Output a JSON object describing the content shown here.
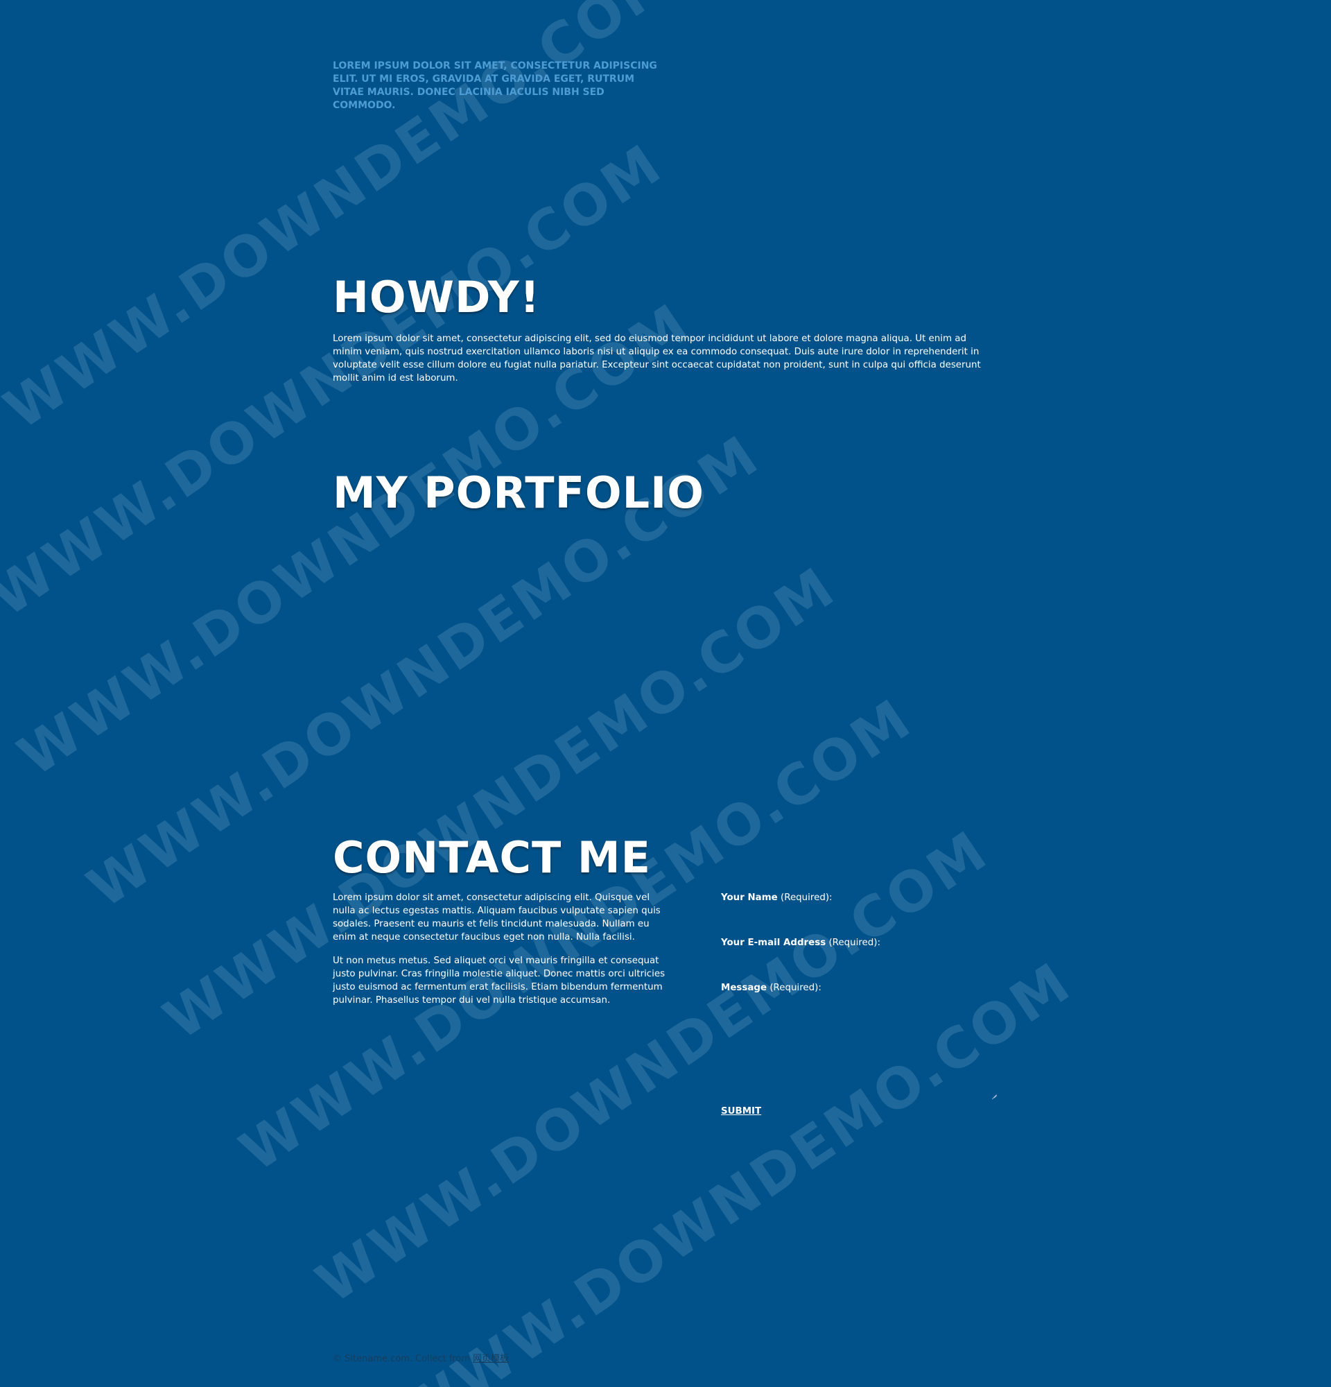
{
  "header": {
    "tagline": "Lorem ipsum dolor sit amet, consectetur adipiscing elit. Ut mi eros, gravida at gravida eget, rutrum vitae mauris. Donec lacinia iaculis nibh sed commodo."
  },
  "howdy": {
    "title": "HOWDY!",
    "text": "Lorem ipsum dolor sit amet, consectetur adipiscing elit, sed do eiusmod tempor incididunt ut labore et dolore magna aliqua. Ut enim ad minim veniam, quis nostrud exercitation ullamco laboris nisi ut aliquip ex ea commodo consequat. Duis aute irure dolor in reprehenderit in voluptate velit esse cillum dolore eu fugiat nulla pariatur. Excepteur sint occaecat cupidatat non proident, sunt in culpa qui officia deserunt mollit anim id est laborum."
  },
  "portfolio": {
    "title": "MY PORTFOLIO"
  },
  "contact": {
    "title": "CONTACT ME",
    "paragraphs": [
      "Lorem ipsum dolor sit amet, consectetur adipiscing elit. Quisque vel nulla ac lectus egestas mattis. Aliquam faucibus vulputate sapien quis sodales. Praesent eu mauris et felis tincidunt malesuada. Nullam eu enim at neque consectetur faucibus eget non nulla. Nulla facilisi.",
      "Ut non metus metus. Sed aliquet orci vel mauris fringilla et consequat justo pulvinar. Cras fringilla molestie aliquet. Donec mattis orci ultricies justo euismod ac fermentum erat facilisis. Etiam bibendum fermentum pulvinar. Phasellus tempor dui vel nulla tristique accumsan."
    ],
    "form": {
      "name_label": "Your Name",
      "email_label": "Your E-mail Address",
      "message_label": "Message",
      "required_text": "(Required):",
      "submit_label": "SUBMIT"
    }
  },
  "footer": {
    "text": "© Sitename.com. Collect from",
    "link_text": "网页模板"
  },
  "watermark": {
    "text": "WWW.DOWNDEMO.COM"
  },
  "colors": {
    "background": "#01528a",
    "tagline": "#4d9cd4",
    "footer": "#163e5f"
  }
}
